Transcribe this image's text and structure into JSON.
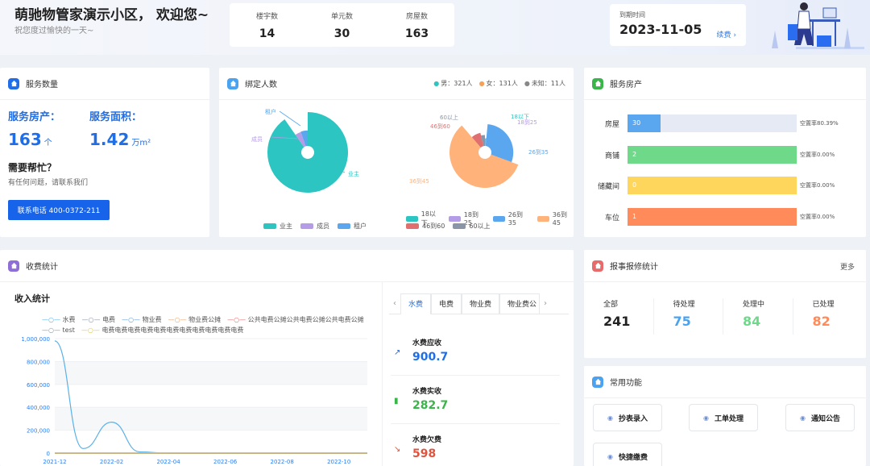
{
  "header": {
    "welcome": "萌驰物管家演示小区， 欢迎您~",
    "subtitle": "祝您度过愉快的一天~",
    "stats": [
      {
        "label": "楼宇数",
        "value": "14"
      },
      {
        "label": "单元数",
        "value": "30"
      },
      {
        "label": "房屋数",
        "value": "163"
      }
    ],
    "expire_label": "到期时间",
    "expire_date": "2023-11-05",
    "renew_label": "续费 ›"
  },
  "service_count": {
    "title": "服务数量",
    "house_label": "服务房产：",
    "house_value": "163",
    "house_unit": "个",
    "area_label": "服务面积：",
    "area_value": "1.42",
    "area_unit": "万m²",
    "help_title": "需要帮忙？",
    "help_sub": "有任何问题，请联系我们",
    "phone_button": "联系电话 400-0372-211"
  },
  "bound_people": {
    "title": "绑定人数",
    "gender_legend": [
      {
        "label": "男：321人",
        "color": "#2dc5c2"
      },
      {
        "label": "女：131人",
        "color": "#f5a15a"
      },
      {
        "label": "未知：11人",
        "color": "#888888"
      }
    ],
    "role_legend": [
      {
        "label": "业主",
        "color": "#2dc5c2"
      },
      {
        "label": "成员",
        "color": "#b49ce6"
      },
      {
        "label": "租户",
        "color": "#5aa7f0"
      }
    ],
    "age_legend": [
      {
        "label": "18以下",
        "color": "#2dc5c2"
      },
      {
        "label": "18到25",
        "color": "#b49ce6"
      },
      {
        "label": "26到35",
        "color": "#5aa7f0"
      },
      {
        "label": "36到45",
        "color": "#ffb27a"
      },
      {
        "label": "46到60",
        "color": "#e07070"
      },
      {
        "label": "60以上",
        "color": "#8a96a8"
      }
    ],
    "role_labels": {
      "owner": "业主",
      "member": "成员",
      "tenant": "租户"
    },
    "age_labels": {
      "a": "60以上",
      "b": "46到60",
      "c": "18以下",
      "d": "18到25",
      "e": "26到35",
      "f": "36到45"
    }
  },
  "chart_data": [
    {
      "type": "pie",
      "title": "",
      "labels": [
        "业主",
        "成员",
        "租户"
      ],
      "values": [
        400,
        20,
        23
      ],
      "colors": [
        "#2dc5c2",
        "#b49ce6",
        "#5aa7f0"
      ]
    },
    {
      "type": "pie",
      "title": "",
      "labels": [
        "18以下",
        "18到25",
        "26到35",
        "36到45",
        "46到60",
        "60以上"
      ],
      "values": [
        2,
        3,
        95,
        190,
        25,
        12
      ],
      "colors": [
        "#2dc5c2",
        "#b49ce6",
        "#5aa7f0",
        "#ffb27a",
        "#e07070",
        "#8a96a8"
      ]
    },
    {
      "type": "line",
      "title": "收入统计",
      "x": [
        "2021-12",
        "2022-01",
        "2022-02",
        "2022-03",
        "2022-04",
        "2022-05",
        "2022-06",
        "2022-07",
        "2022-08",
        "2022-09",
        "2022-10",
        "2022-11"
      ],
      "x_tick_labels": [
        "2021-12",
        "2022-02",
        "2022-04",
        "2022-06",
        "2022-08",
        "2022-10"
      ],
      "ylim": [
        0,
        1000000
      ],
      "y_ticks": [
        "0",
        "200,000",
        "400,000",
        "600,000",
        "800,000",
        "1,000,000"
      ],
      "series": [
        {
          "name": "水费",
          "color": "#5ab0e8",
          "values": [
            980000,
            40000,
            270000,
            10000,
            0,
            0,
            0,
            0,
            0,
            0,
            0,
            0
          ]
        },
        {
          "name": "电费",
          "color": "#8a96a8",
          "values": [
            0,
            0,
            0,
            0,
            0,
            0,
            0,
            0,
            0,
            0,
            0,
            0
          ]
        },
        {
          "name": "物业费",
          "color": "#5a9be0",
          "values": [
            0,
            0,
            0,
            0,
            0,
            0,
            0,
            0,
            0,
            0,
            0,
            0
          ]
        },
        {
          "name": "物业费公摊",
          "color": "#f3a36a",
          "values": [
            0,
            0,
            0,
            0,
            0,
            0,
            0,
            0,
            0,
            0,
            0,
            0
          ]
        },
        {
          "name": "公共电费公摊公共电费公摊公共电费公摊",
          "color": "#e07070",
          "values": [
            0,
            0,
            0,
            0,
            0,
            0,
            0,
            0,
            0,
            0,
            0,
            0
          ]
        },
        {
          "name": "test",
          "color": "#8a96a8",
          "values": [
            0,
            0,
            0,
            0,
            0,
            0,
            0,
            0,
            0,
            0,
            0,
            0
          ]
        },
        {
          "name": "电费电费电费电费电费电费电费电费电费电费电费",
          "color": "#e6c93a",
          "values": [
            2000,
            2000,
            2000,
            2000,
            2000,
            2000,
            2000,
            2000,
            2000,
            2000,
            2000,
            2000
          ]
        }
      ]
    },
    {
      "type": "bar",
      "title": "",
      "categories": [
        "房屋",
        "商铺",
        "储藏间",
        "车位"
      ],
      "values": [
        30,
        2,
        0,
        1
      ],
      "vacancy": [
        "空置率80.39%",
        "空置率0.00%",
        "空置率0.00%",
        "空置率0.00%"
      ],
      "colors": [
        "#5aa7f0",
        "#6fd98a",
        "#ffd65c",
        "#ff8a5a"
      ]
    }
  ],
  "service_property": {
    "title": "服务房产",
    "fractions": [
      0.196,
      1.0,
      1.0,
      1.0
    ]
  },
  "fee": {
    "title": "收费统计",
    "tabs": [
      "水费",
      "电费",
      "物业费",
      "物业费公"
    ],
    "items": [
      {
        "title": "水费应收",
        "value": "900.7",
        "color": "#1f6ee8",
        "icon": "trend-up-icon"
      },
      {
        "title": "水费实收",
        "value": "282.7",
        "color": "#39b54a",
        "icon": "bar-icon"
      },
      {
        "title": "水费欠费",
        "value": "598",
        "color": "#e0533d",
        "icon": "trend-down-icon"
      }
    ]
  },
  "repair": {
    "title": "报事报修统计",
    "more": "更多",
    "cells": [
      {
        "label": "全部",
        "value": "241",
        "color": "#222222"
      },
      {
        "label": "待处理",
        "value": "75",
        "color": "#4aa3f0"
      },
      {
        "label": "处理中",
        "value": "84",
        "color": "#6fd98a"
      },
      {
        "label": "已处理",
        "value": "82",
        "color": "#ff8a5a"
      }
    ]
  },
  "functions": {
    "title": "常用功能",
    "buttons": [
      "抄表录入",
      "工单处理",
      "通知公告",
      "快捷缴费"
    ]
  },
  "colors": {
    "accent": "#1f6ee8",
    "bg": "#eef1f6"
  }
}
